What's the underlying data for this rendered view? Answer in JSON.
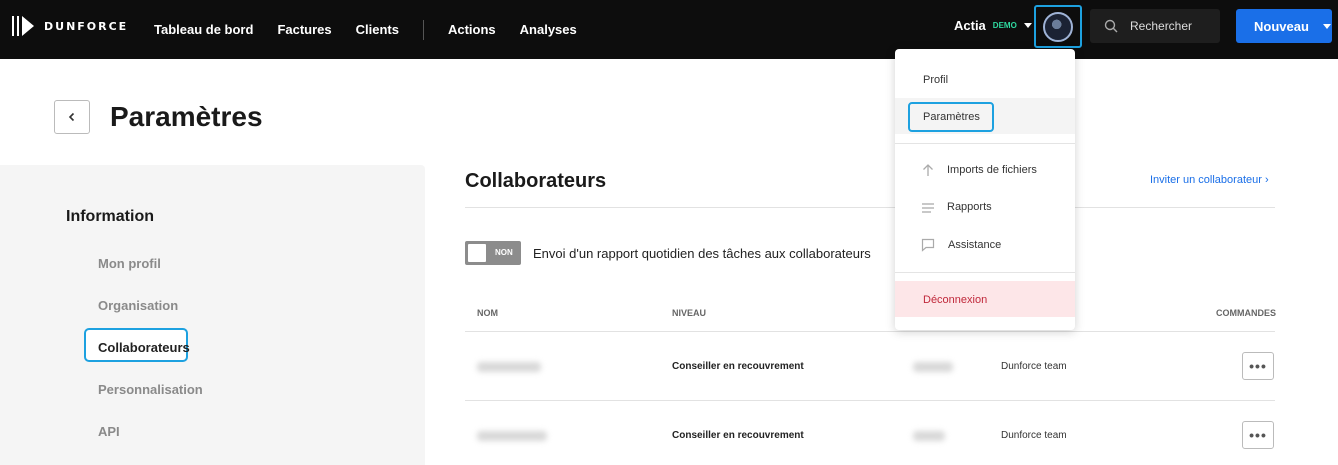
{
  "header": {
    "logo_text": "DUNFORCE",
    "nav": [
      "Tableau de bord",
      "Factures",
      "Clients"
    ],
    "nav2": [
      "Actions",
      "Analyses"
    ],
    "company": "Actia",
    "company_badge": "DEMO",
    "search_placeholder": "Rechercher",
    "new_button": "Nouveau"
  },
  "page": {
    "title": "Paramètres"
  },
  "sidebar": {
    "section": "Information",
    "items": [
      "Mon profil",
      "Organisation",
      "Collaborateurs",
      "Personnalisation",
      "API"
    ],
    "active": "Collaborateurs"
  },
  "main": {
    "title": "Collaborateurs",
    "invite_link": "Inviter un collaborateur ›",
    "toggle_label": "NON",
    "toggle_text": "Envoi d'un rapport quotidien des tâches aux collaborateurs",
    "columns": [
      "NOM",
      "NIVEAU",
      "COMMANDES"
    ],
    "rows": [
      {
        "level": "Conseiller en recouvrement",
        "team": "Dunforce team"
      },
      {
        "level": "Conseiller en recouvrement",
        "team": "Dunforce team"
      }
    ]
  },
  "dropdown": {
    "items": [
      "Profil",
      "Paramètres",
      "Imports de fichiers",
      "Rapports",
      "Assistance",
      "Déconnexion"
    ],
    "icons": [
      "arrow-up-icon",
      "list-icon",
      "chat-icon"
    ]
  },
  "colors": {
    "accent": "#1a6fe8",
    "focus": "#1da1e0",
    "demo": "#2fd9a0",
    "logout_bg": "#fde6e8",
    "logout_text": "#c0283a"
  }
}
